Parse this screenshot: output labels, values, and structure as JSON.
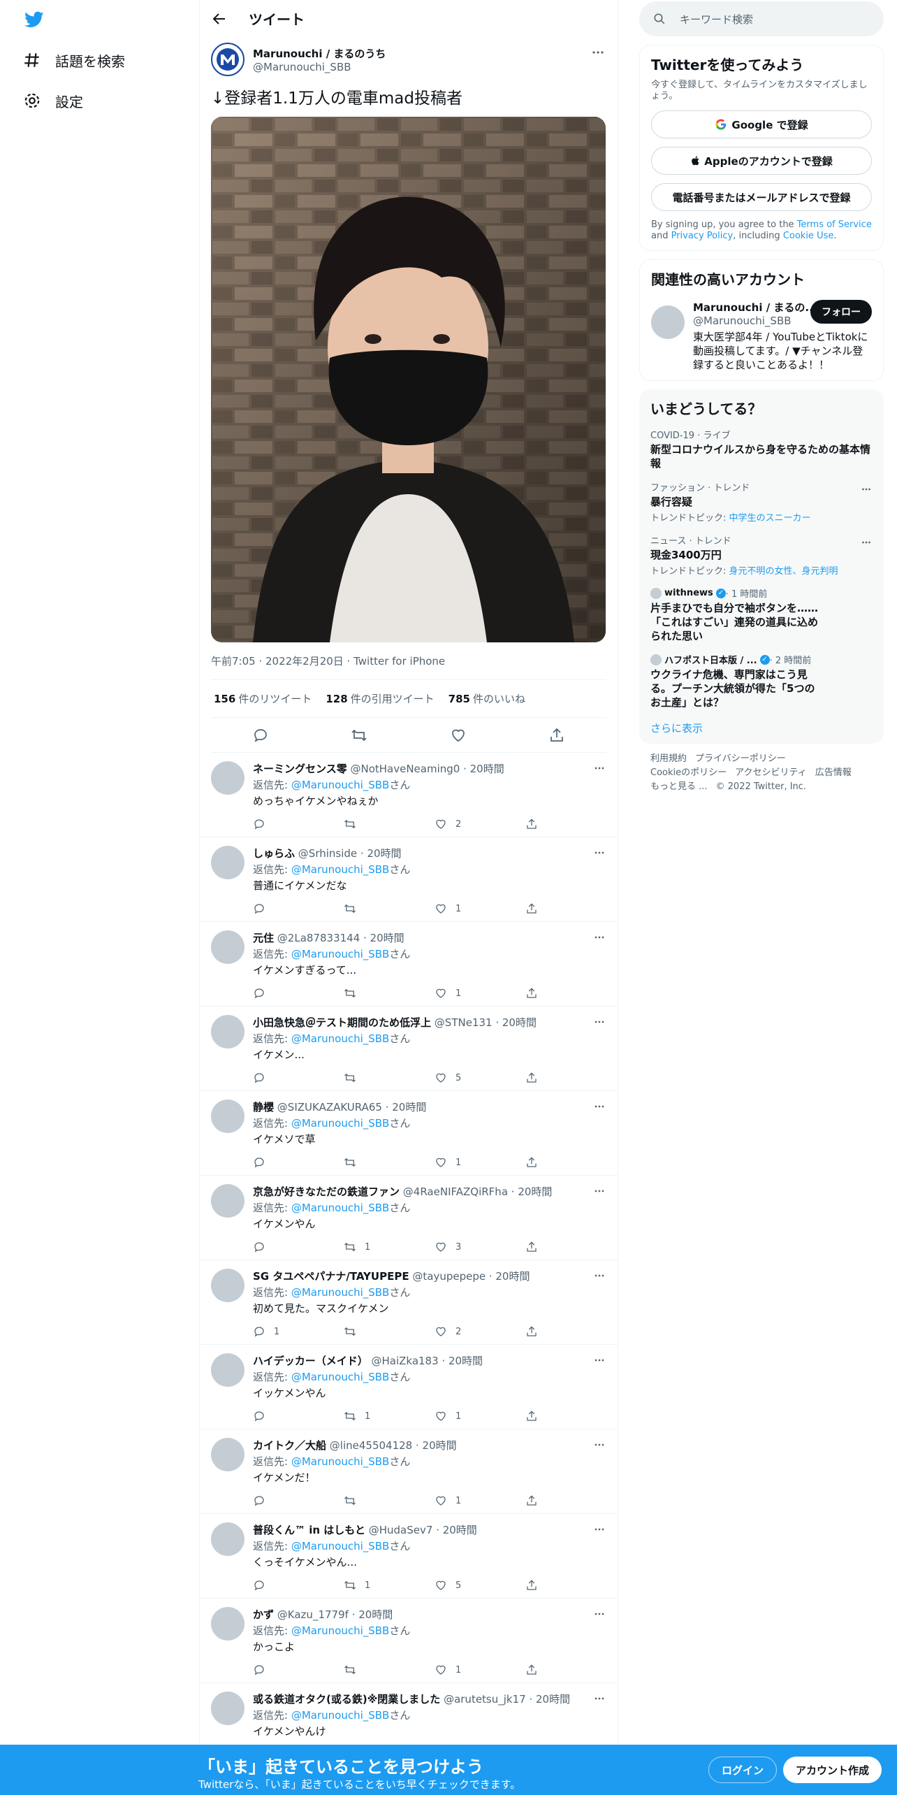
{
  "nav": {
    "explore": "話題を検索",
    "settings": "設定"
  },
  "header": {
    "title": "ツイート"
  },
  "tweet": {
    "name": "Marunouchi / まるのうち",
    "handle": "@Marunouchi_SBB",
    "text": "↓登録者1.1万人の電車mad投稿者",
    "meta": "午前7:05 · 2022年2月20日 · Twitter for iPhone",
    "retweets_num": "156",
    "retweets_label": "件のリツイート",
    "quotes_num": "128",
    "quotes_label": "件の引用ツイート",
    "likes_num": "785",
    "likes_label": "件のいいね"
  },
  "replies": [
    {
      "name": "ネーミングセンス零",
      "meta": "@NotHaveNeaming0 · 20時間",
      "to": "@Marunouchi_SBB",
      "text": "めっちゃイケメンやねぇか",
      "reply": "",
      "rt": "",
      "like": "2"
    },
    {
      "name": "しゅらふ",
      "meta": "@Srhinside · 20時間",
      "to": "@Marunouchi_SBB",
      "text": "普通にイケメンだな",
      "reply": "",
      "rt": "",
      "like": "1"
    },
    {
      "name": "元住",
      "meta": "@2La87833144 · 20時間",
      "to": "@Marunouchi_SBB",
      "text": "イケメンすぎるって...",
      "reply": "",
      "rt": "",
      "like": "1"
    },
    {
      "name": "小田急快急＠テスト期間のため低浮上",
      "meta": "@STNe131 · 20時間",
      "to": "@Marunouchi_SBB",
      "text": "イケメン...",
      "reply": "",
      "rt": "",
      "like": "5"
    },
    {
      "name": "静櫻",
      "meta": "@SIZUKAZAKURA65 · 20時間",
      "to": "@Marunouchi_SBB",
      "text": "イケメソで草",
      "reply": "",
      "rt": "",
      "like": "1"
    },
    {
      "name": "京急が好きなただの鉄道ファン",
      "meta": "@4RaeNIFAZQiRFha · 20時間",
      "to": "@Marunouchi_SBB",
      "text": "イケメンやん",
      "reply": "",
      "rt": "1",
      "like": "3"
    },
    {
      "name": "SG タユペペパナナ/TAYUPEPE",
      "meta": "@tayupepepe · 20時間",
      "to": "@Marunouchi_SBB",
      "text": "初めて見た。マスクイケメン",
      "reply": "1",
      "rt": "",
      "like": "2"
    },
    {
      "name": "ハイデッカー（メイド）",
      "meta": "@HaiZka183 · 20時間",
      "to": "@Marunouchi_SBB",
      "text": "イッケメンやん",
      "reply": "",
      "rt": "1",
      "like": "1"
    },
    {
      "name": "カイトク／大船",
      "meta": "@line45504128 · 20時間",
      "to": "@Marunouchi_SBB",
      "text": "イケメンだ！",
      "reply": "",
      "rt": "",
      "like": "1"
    },
    {
      "name": "普段くん™ in はしもと",
      "meta": "@HudaSev7 · 20時間",
      "to": "@Marunouchi_SBB",
      "text": "くっそイケメンやん...",
      "reply": "",
      "rt": "1",
      "like": "5"
    },
    {
      "name": "かず",
      "meta": "@Kazu_1779f · 20時間",
      "to": "@Marunouchi_SBB",
      "text": "かっこよ",
      "reply": "",
      "rt": "",
      "like": "1"
    },
    {
      "name": "或る鉄道オタク(或る鉄)※閉業しました",
      "meta": "@arutetsu_jk17 · 20時間",
      "to": "@Marunouchi_SBB",
      "text": "イケメンやんけ",
      "reply": "",
      "rt": "",
      "like": ""
    }
  ],
  "reply_to_prefix": "返信先: ",
  "reply_to_suffix": "さん",
  "search": {
    "placeholder": "キーワード検索"
  },
  "signup_card": {
    "title": "Twitterを使ってみよう",
    "desc": "今すぐ登録して、タイムラインをカスタマイズしましょう。",
    "google": "Google で登録",
    "apple": "Appleのアカウントで登録",
    "phone": "電話番号またはメールアドレスで登録",
    "terms_1": "By signing up, you agree to the ",
    "terms_link": "Terms of Service",
    "terms_2": " and ",
    "privacy_link": "Privacy Policy",
    "terms_3": ", including ",
    "cookie_link": "Cookie Use",
    "terms_4": "."
  },
  "related": {
    "title": "関連性の高いアカウント",
    "name": "Marunouchi / まるの...",
    "handle": "@Marunouchi_SBB",
    "follow": "フォロー",
    "bio": "東大医学部4年 / YouTubeとTiktokに動画投稿してます。/ ▼チャンネル登録すると良いことあるよ！！"
  },
  "trends": {
    "title": "いまどうしてる？",
    "items": [
      {
        "cat": "COVID-19 · ライブ",
        "title": "新型コロナウイルスから身を守るための基本情報",
        "sub": "",
        "sublink": ""
      },
      {
        "cat": "ファッション · トレンド",
        "title": "暴行容疑",
        "sub": "トレンドトピック: ",
        "sublink": "中学生のスニーカー"
      },
      {
        "cat": "ニュース · トレンド",
        "title": "現金3400万円",
        "sub": "トレンドトピック: ",
        "sublink": "身元不明の女性、身元判明"
      }
    ],
    "news": [
      {
        "source": "withnews",
        "time": " · 1 時間前",
        "title": "片手まひでも自分で袖ボタンを……「これはすごい」連発の道具に込められた思い"
      },
      {
        "source": "ハフポスト日本版 / ...",
        "time": " · 2 時間前",
        "title": "ウクライナ危機、専門家はこう見る。プーチン大統領が得た「5つのお土産」とは？"
      }
    ],
    "more": "さらに表示"
  },
  "footer": {
    "terms": "利用規約",
    "privacy": "プライバシーポリシー",
    "cookie": "Cookieのポリシー",
    "accessibility": "アクセシビリティ",
    "ads": "広告情報",
    "more": "もっと見る ...",
    "copyright": "© 2022 Twitter, Inc."
  },
  "bottom": {
    "title": "「いま」起きていることを見つけよう",
    "sub": "Twitterなら、「いま」起きていることをいち早くチェックできます。",
    "login": "ログイン",
    "signup": "アカウント作成"
  },
  "colors": {
    "accent": "#1d9bf0",
    "text": "#0f1419",
    "muted": "#536471"
  }
}
